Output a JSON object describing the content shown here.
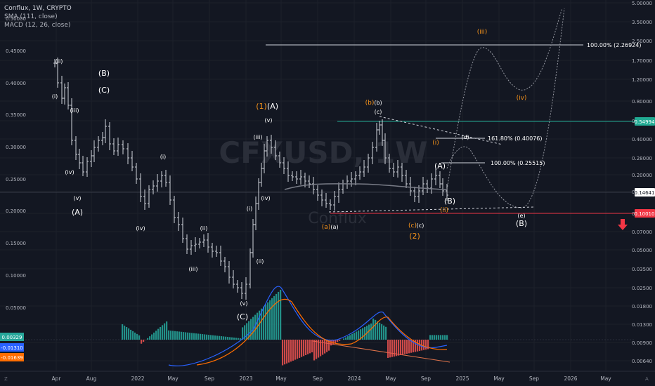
{
  "legend": {
    "symbol_line": "Conflux, 1W, CRYPTO",
    "sma_line": "SMA (111, close)",
    "macd_line": "MACD (12, 26, close)"
  },
  "watermark": {
    "ticker": "CFXUSD, 1W",
    "name": "Conflux"
  },
  "chart_data": {
    "type": "line",
    "title": "Conflux, 1W, CRYPTO",
    "y_scale": "log",
    "left_axis_ticks": [
      "0.50000",
      "0.45000",
      "0.40000",
      "0.35000",
      "0.30000",
      "0.25000",
      "0.20000",
      "0.15000",
      "0.10000",
      "0.05000"
    ],
    "right_axis_ticks": [
      "5.00000",
      "3.50000",
      "2.50000",
      "1.70000",
      "1.20000",
      "0.80000",
      "0.55000",
      "0.40000",
      "0.28000",
      "0.20000",
      "0.14000",
      "0.10000",
      "0.07000",
      "0.05000",
      "0.03500",
      "0.02500",
      "0.01800",
      "0.01300",
      "0.00900",
      "0.00640"
    ],
    "x_ticks": [
      "Apr",
      "Aug",
      "2022",
      "May",
      "Sep",
      "2023",
      "May",
      "Sep",
      "2024",
      "May",
      "Sep",
      "2025",
      "May",
      "Sep",
      "2026",
      "May"
    ],
    "current_price": "0.14641",
    "resistance_label": "0.54994",
    "support_label": "0.10010",
    "macd_values": [
      "0.00329",
      "-0.01310",
      "-0.01639"
    ],
    "fib_levels": [
      {
        "label": "100.00% (2.26924)"
      },
      {
        "label": "161.80% (0.40076)"
      },
      {
        "label": "100.00% (0.25515)"
      }
    ],
    "wave_labels": {
      "white": [
        "(i)",
        "(ii)",
        "(iii)",
        "(iv)",
        "(v)",
        "(A)",
        "(B)",
        "(C)",
        "(i)",
        "(ii)",
        "(iii)",
        "(iv)",
        "(v)",
        "(C)",
        "(iii)",
        "(v)",
        "(A)",
        "(iv)",
        "(ii)",
        "(i)",
        "(b)",
        "(c)",
        "(a)",
        "(c)",
        "(B)",
        "(A)",
        "(B)",
        "(e)",
        "(d)"
      ],
      "orange": [
        "(1)",
        "(b)",
        "(a)",
        "(c)",
        "(2)",
        "(i)",
        "(ii)",
        "(iii)",
        "(iv)"
      ]
    },
    "series": [
      {
        "name": "SMA (111, close)"
      },
      {
        "name": "MACD (12, 26, close)"
      }
    ]
  }
}
